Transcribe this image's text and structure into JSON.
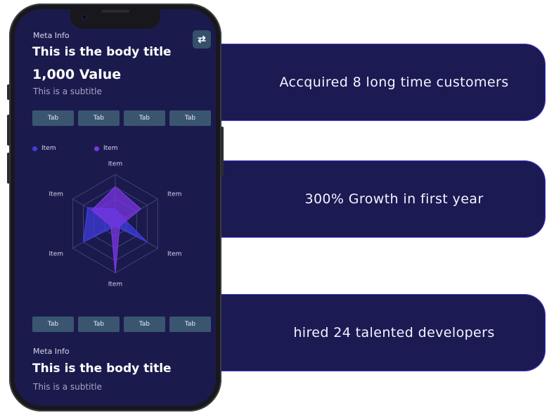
{
  "cards": [
    "Accquired 8 long time customers",
    "300% Growth in first year",
    "hired 24 talented developers"
  ],
  "top": {
    "meta": "Meta Info",
    "body_title": "This is the body title",
    "value": "1,000 Value",
    "subtitle": "This is a subtitle"
  },
  "tabs_top": [
    "Tab",
    "Tab",
    "Tab",
    "Tab"
  ],
  "tabs_bottom": [
    "Tab",
    "Tab",
    "Tab",
    "Tab"
  ],
  "legend": [
    "Item",
    "Item"
  ],
  "radar_labels": [
    "Item",
    "Item",
    "Item",
    "Item",
    "Item",
    "Item"
  ],
  "bottom": {
    "meta": "Meta Info",
    "body_title": "This is the body title",
    "subtitle": "This is a subtitle"
  },
  "icons": {
    "swap": "swap-arrows-icon"
  },
  "colors": {
    "series1": "#3f3de0",
    "series2": "#7b36e6",
    "card_bg": "#1b1a53",
    "screen_bg": "#1b1a4d"
  },
  "chart_data": {
    "type": "radar",
    "axes": [
      "Item",
      "Item",
      "Item",
      "Item",
      "Item",
      "Item"
    ],
    "series": [
      {
        "values": [
          0.3,
          0.2,
          0.75,
          0.05,
          0.75,
          0.65
        ]
      },
      {
        "values": [
          0.75,
          0.6,
          0.1,
          1.0,
          0.1,
          0.55
        ]
      }
    ],
    "rlim": [
      0,
      1
    ],
    "grid_levels": 4
  }
}
